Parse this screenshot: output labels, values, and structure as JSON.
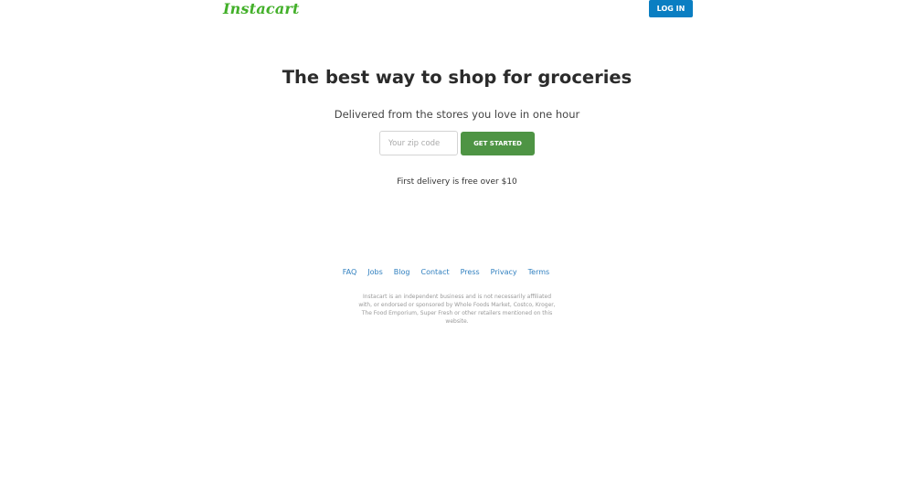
{
  "header": {
    "logo_text": "Instacart",
    "login_label": "LOG IN"
  },
  "hero": {
    "title": "The best way to shop for groceries",
    "subtitle": "Delivered from the stores you love in one hour",
    "zip_placeholder": "Your zip code",
    "zip_value": "",
    "cta_label": "GET STARTED",
    "promo": "First delivery is free over $10"
  },
  "footer": {
    "links": [
      "FAQ",
      "Jobs",
      "Blog",
      "Contact",
      "Press",
      "Privacy",
      "Terms"
    ],
    "social_icons": [
      {
        "name": "facebook-icon",
        "glyph": ""
      },
      {
        "name": "twitter-icon",
        "glyph": ""
      }
    ],
    "disclaimer": "Instacart is an independent business and is not necessarily affiliated with, or endorsed or sponsored by Whole Foods Market, Costco, Kroger, The Food Emporium, Super Fresh or other retailers mentioned on this website."
  },
  "colors": {
    "brand_green": "#43b02a",
    "cta_green": "#4e9444",
    "login_blue": "#0a7ec2",
    "link_blue": "#2f7fbf"
  }
}
